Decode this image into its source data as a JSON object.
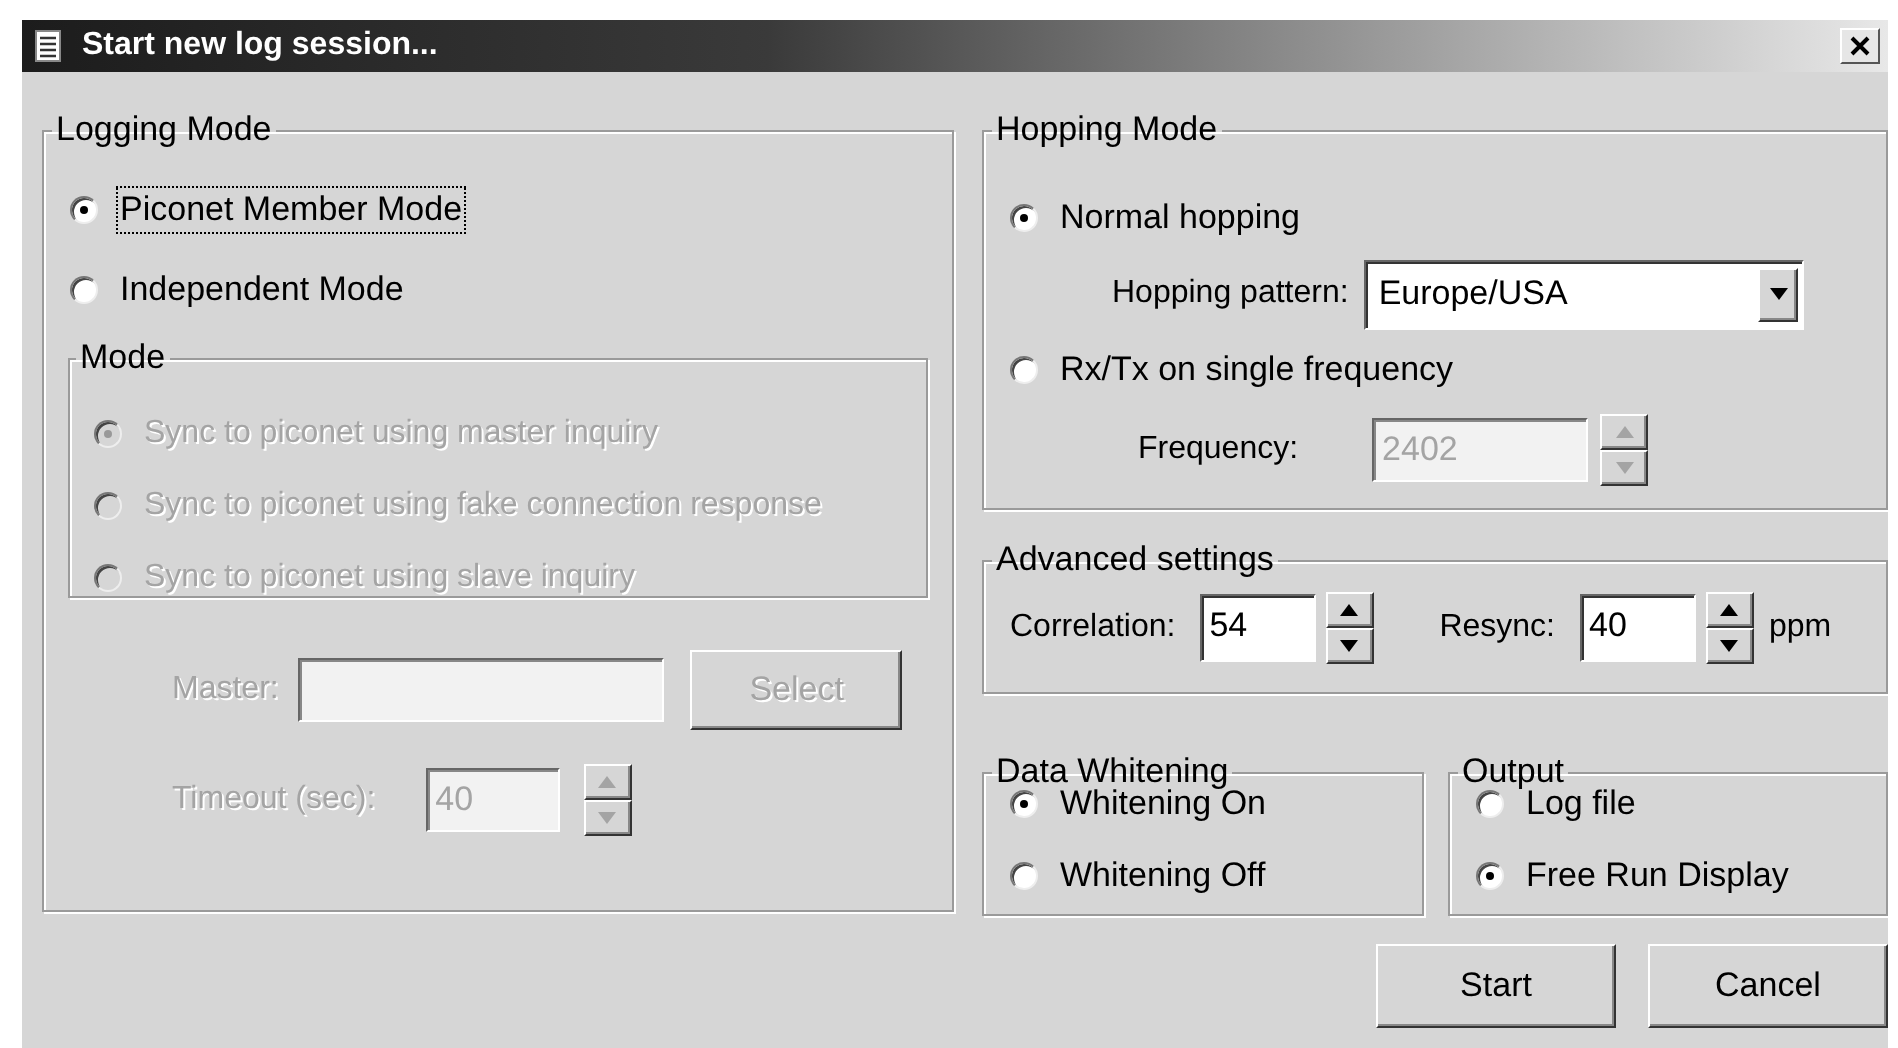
{
  "window": {
    "title": "Start new log session..."
  },
  "logging_mode": {
    "title": "Logging Mode",
    "options": [
      {
        "label": "Piconet Member Mode",
        "selected": true,
        "focused": true
      },
      {
        "label": "Independent Mode",
        "selected": false,
        "focused": false
      }
    ],
    "mode": {
      "title": "Mode",
      "disabled": true,
      "options": [
        {
          "label": "Sync to piconet using master inquiry",
          "selected": true
        },
        {
          "label": "Sync to piconet using fake connection response",
          "selected": false
        },
        {
          "label": "Sync to piconet using slave inquiry",
          "selected": false
        }
      ]
    },
    "master": {
      "label": "Master:",
      "disabled": true
    },
    "select_button": {
      "label": "Select",
      "disabled": true
    },
    "timeout": {
      "label": "Timeout (sec):",
      "value": "40",
      "disabled": true
    }
  },
  "hopping_mode": {
    "title": "Hopping Mode",
    "options": [
      {
        "label": "Normal hopping",
        "selected": true
      },
      {
        "label": "Rx/Tx on single frequency",
        "selected": false
      }
    ],
    "pattern": {
      "label": "Hopping pattern:",
      "value": "Europe/USA"
    },
    "frequency": {
      "label": "Frequency:",
      "value": "2402",
      "disabled": true
    }
  },
  "advanced_settings": {
    "title": "Advanced settings",
    "correlation": {
      "label": "Correlation:",
      "value": "54"
    },
    "resync": {
      "label": "Resync:",
      "value": "40",
      "unit": "ppm"
    }
  },
  "data_whitening": {
    "title": "Data Whitening",
    "options": [
      {
        "label": "Whitening On",
        "selected": true
      },
      {
        "label": "Whitening Off",
        "selected": false
      }
    ]
  },
  "output": {
    "title": "Output",
    "options": [
      {
        "label": "Log file",
        "selected": false
      },
      {
        "label": "Free Run Display",
        "selected": true
      }
    ]
  },
  "buttons": [
    {
      "label": "Start"
    },
    {
      "label": "Cancel"
    }
  ]
}
